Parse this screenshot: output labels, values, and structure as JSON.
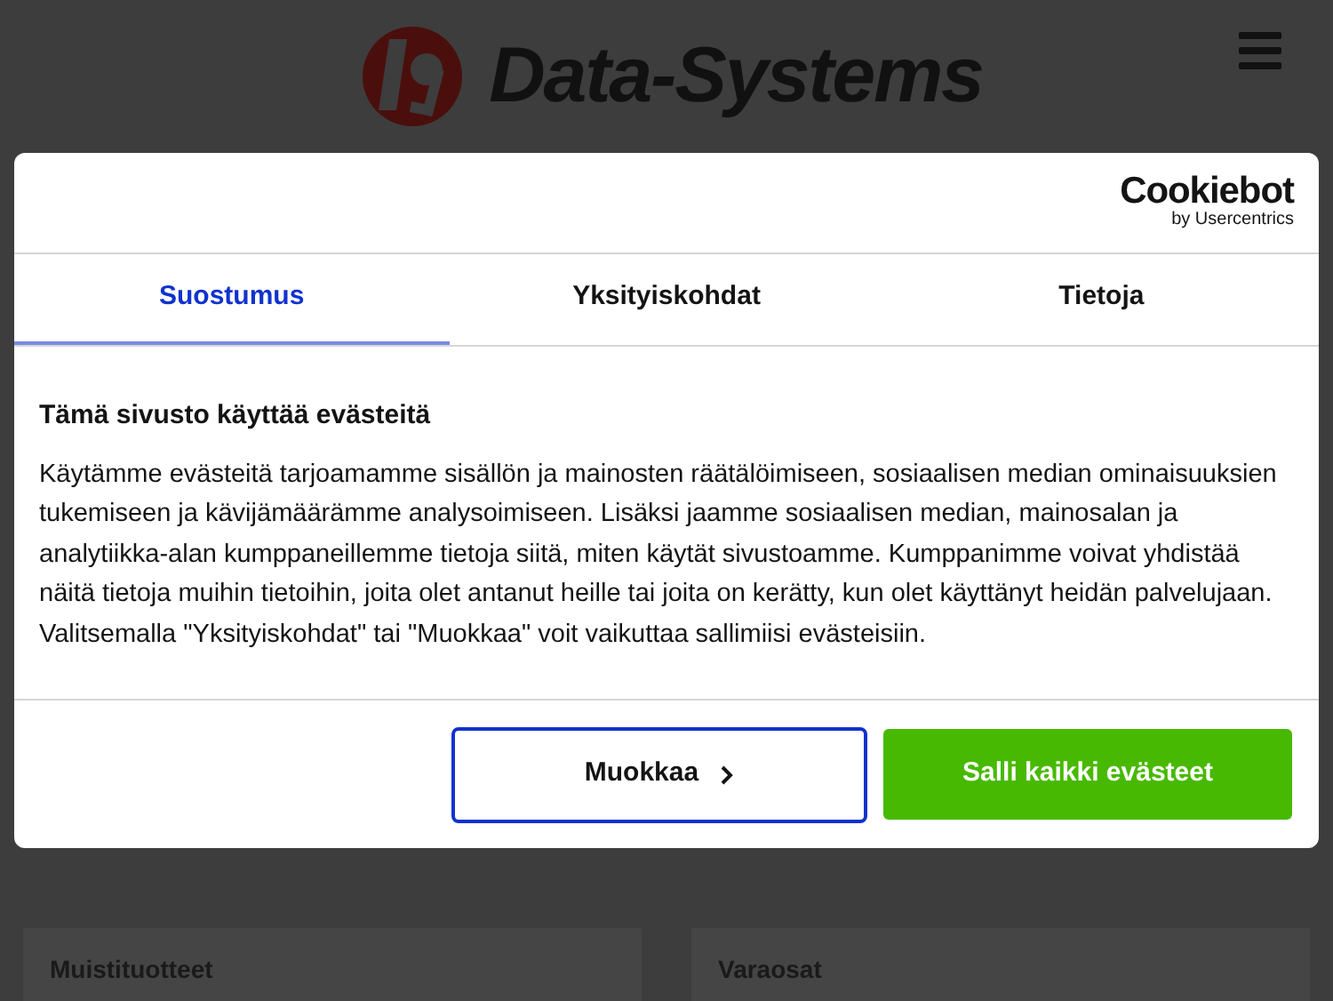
{
  "header": {
    "brand": "Data-Systems"
  },
  "dialog": {
    "provider": {
      "name": "Cookiebot",
      "byline": "by Usercentrics"
    },
    "tabs": [
      {
        "label": "Suostumus",
        "selected": true
      },
      {
        "label": "Yksityiskohdat",
        "selected": false
      },
      {
        "label": "Tietoja",
        "selected": false
      }
    ],
    "heading": "Tämä sivusto käyttää evästeitä",
    "body": "Käytämme evästeitä tarjoamamme sisällön ja mainosten räätälöimiseen, sosiaalisen median ominaisuuksien tukemiseen ja kävijämäärämme analysoimiseen. Lisäksi jaamme sosiaalisen median, mainosalan ja analytiikka-alan kumppaneillemme tietoja siitä, miten käytät sivustoamme. Kumppanimme voivat yhdistää näitä tietoja muihin tietoihin, joita olet antanut heille tai joita on kerätty, kun olet käyttänyt heidän palvelujaan. Valitsemalla \"Yksityiskohdat\" tai \"Muokkaa\" voit vaikuttaa sallimiisi evästeisiin.",
    "buttons": [
      {
        "label": "Muokkaa",
        "kind": "outline"
      },
      {
        "label": "Salli kaikki evästeet",
        "kind": "primary"
      }
    ]
  },
  "categories": [
    {
      "title": "Muistituotteet"
    },
    {
      "title": "Varaosat"
    }
  ]
}
